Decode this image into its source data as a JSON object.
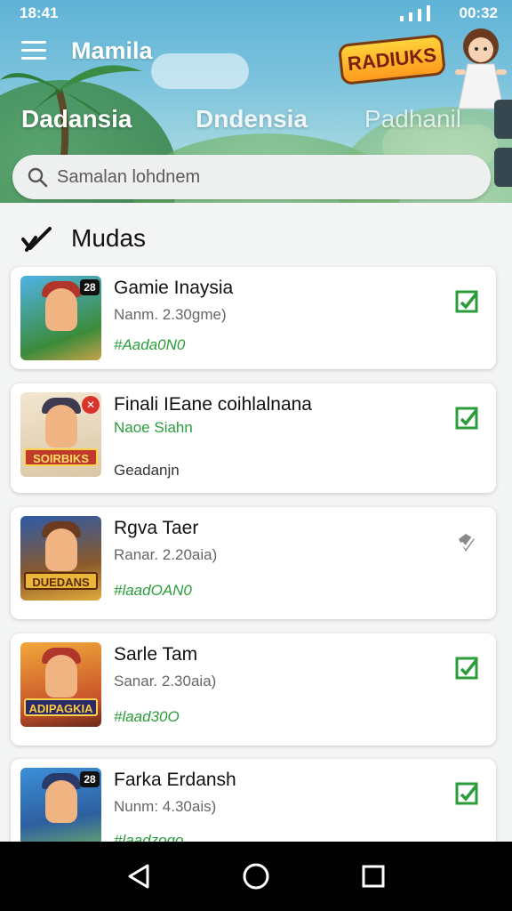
{
  "status_bar": {
    "time_left": "18:41",
    "time_right": "00:32"
  },
  "app": {
    "title": "Mamila",
    "logo_text": "RADIUKS"
  },
  "tabs": [
    {
      "label": "Dadansia",
      "active": true
    },
    {
      "label": "Dndensia",
      "active": false
    },
    {
      "label": "Padhanil",
      "active": false
    }
  ],
  "search": {
    "placeholder": "Samalan lohdnem",
    "value": ""
  },
  "section": {
    "title": "Mudas",
    "icon": "check-stroke-icon"
  },
  "games": [
    {
      "title": "Gamie Inaysia",
      "subtitle": "Nanm. 2.30gme)",
      "tag": "#Aada0N0",
      "badge": "28",
      "thumb_banner": "",
      "action": "checked"
    },
    {
      "title": "Finali IEane coihlalnana",
      "subtitle": "Naoe Siahn",
      "tag": "Geadanjn",
      "badge": "",
      "thumb_banner": "SOIRBIKS",
      "action": "checked"
    },
    {
      "title": "Rgva Taer",
      "subtitle": "Ranar. 2.20aia)",
      "tag": "#laadOAN0",
      "badge": "",
      "thumb_banner": "DUEDANS",
      "action": "pending"
    },
    {
      "title": "Sarle Tam",
      "subtitle": "Sanar. 2.30aia)",
      "tag": "#laad30O",
      "badge": "",
      "thumb_banner": "ADIPAGKIA",
      "action": "checked"
    },
    {
      "title": "Farka Erdansh",
      "subtitle": "Nunm: 4.30ais)",
      "tag": "#laadzogo",
      "badge": "28",
      "thumb_banner": "",
      "action": "checked"
    }
  ],
  "colors": {
    "accent_green": "#2a9d3a",
    "header_sky": "#7cc3dd",
    "nav_bg": "#000000"
  },
  "nav": {
    "back": "back-icon",
    "home": "home-icon",
    "recents": "recents-icon"
  }
}
